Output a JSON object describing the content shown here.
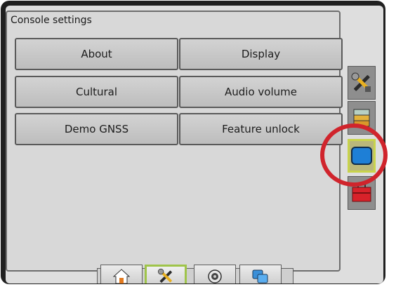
{
  "panel": {
    "title": "Console settings",
    "buttons": [
      {
        "label": "About"
      },
      {
        "label": "Display"
      },
      {
        "label": "Cultural"
      },
      {
        "label": "Audio volume"
      },
      {
        "label": "Demo GNSS"
      },
      {
        "label": "Feature unlock"
      }
    ]
  },
  "side_tabs": [
    {
      "icon": "tools-icon",
      "active": false
    },
    {
      "icon": "storage-icon",
      "active": false
    },
    {
      "icon": "console-display-icon",
      "active": true
    },
    {
      "icon": "toolbox-icon",
      "active": false
    }
  ],
  "bottom_tabs": [
    {
      "icon": "home-icon",
      "active": false
    },
    {
      "icon": "tools-icon",
      "active": true
    },
    {
      "icon": "gps-icon",
      "active": false
    },
    {
      "icon": "data-icon",
      "active": false
    }
  ],
  "colors": {
    "highlight": "#d0242c",
    "active_tab": "#c8d34b",
    "display_icon": "#1e7fd6",
    "toolbox": "#d8222a"
  }
}
